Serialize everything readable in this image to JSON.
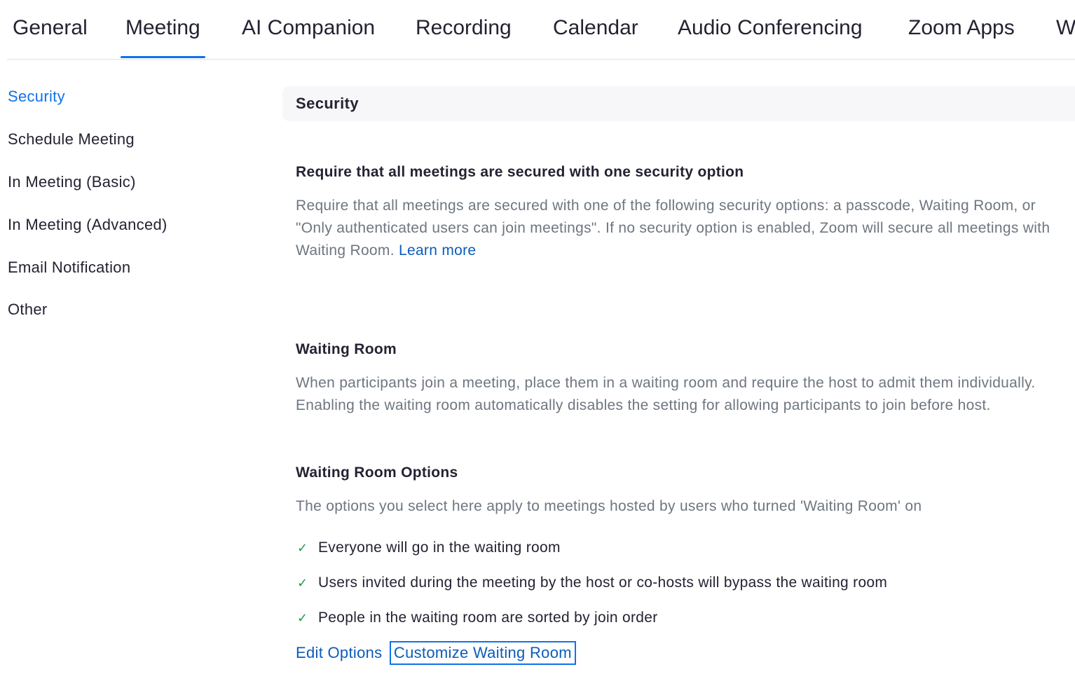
{
  "tabs": [
    {
      "label": "General"
    },
    {
      "label": "Meeting",
      "active": true
    },
    {
      "label": "AI Companion"
    },
    {
      "label": "Recording"
    },
    {
      "label": "Calendar"
    },
    {
      "label": "Audio Conferencing"
    },
    {
      "label": "Zoom Apps"
    },
    {
      "label": "W"
    }
  ],
  "sidebar": {
    "items": [
      {
        "label": "Security",
        "active": true
      },
      {
        "label": "Schedule Meeting"
      },
      {
        "label": "In Meeting (Basic)"
      },
      {
        "label": "In Meeting (Advanced)"
      },
      {
        "label": "Email Notification"
      },
      {
        "label": "Other"
      }
    ]
  },
  "content": {
    "section_title": "Security",
    "require_security": {
      "title": "Require that all meetings are secured with one security option",
      "description": "Require that all meetings are secured with one of the following security options: a passcode, Waiting Room, or \"Only authenticated users can join meetings\". If no security option is enabled, Zoom will secure all meetings with Waiting Room.",
      "learn_more": "Learn more"
    },
    "waiting_room": {
      "title": "Waiting Room",
      "description": "When participants join a meeting, place them in a waiting room and require the host to admit them individually. Enabling the waiting room automatically disables the setting for allowing participants to join before host."
    },
    "waiting_room_options": {
      "title": "Waiting Room Options",
      "description": "The options you select here apply to meetings hosted by users who turned 'Waiting Room' on",
      "options": [
        "Everyone will go in the waiting room",
        "Users invited during the meeting by the host or co-hosts will bypass the waiting room",
        "People in the waiting room are sorted by join order"
      ],
      "edit_options": "Edit Options",
      "customize": "Customize Waiting Room"
    }
  },
  "colors": {
    "accent": "#0e72ed",
    "link": "#0b5cba",
    "check": "#1f9a4a",
    "muted_text": "#6e7680"
  },
  "icons": {
    "check": "check-icon"
  }
}
